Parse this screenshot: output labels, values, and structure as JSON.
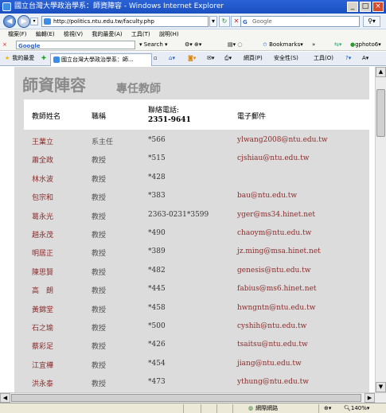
{
  "window": {
    "title": "國立台灣大學政治學系：師資陣容 - Windows Internet Explorer"
  },
  "address": {
    "url": "http://politics.ntu.edu.tw/faculty.php"
  },
  "search": {
    "placeholder": "Google"
  },
  "menu": [
    "檔案(F)",
    "編輯(E)",
    "檢視(V)",
    "我的最愛(A)",
    "工具(T)",
    "說明(H)"
  ],
  "google_toolbar": {
    "logo": "Google",
    "search_label": "Search",
    "bookmarks_label": "Bookmarks",
    "more": "»",
    "gphoto": "gphoto6"
  },
  "tabbar": {
    "favorites": "我的最愛",
    "tab_title": "國立台灣大學政治學系：師...",
    "home_menu": "網頁(P)",
    "safety_menu": "安全性(S)",
    "tools_menu": "工具(O)"
  },
  "page": {
    "title": "師資陣容",
    "subtitle": "專任教師",
    "headers": {
      "name": "教師姓名",
      "title": "職稱",
      "phone": "聯絡電話:",
      "phone_sub": "2351-9641",
      "email": "電子郵件"
    },
    "rows": [
      {
        "name": "王業立",
        "title": "系主任",
        "phone": "*566",
        "email": "ylwang2008@ntu.edu.tw"
      },
      {
        "name": "蕭全政",
        "title": "教授",
        "phone": "*515",
        "email": "cjshiau@ntu.edu.tw"
      },
      {
        "name": "林水波",
        "title": "教授",
        "phone": "*428",
        "email": ""
      },
      {
        "name": "包宗和",
        "title": "教授",
        "phone": "*383",
        "email": "bau@ntu.edu.tw"
      },
      {
        "name": "葛永光",
        "title": "教授",
        "phone": "2363-0231*3599",
        "email": "yger@ms34.hinet.net"
      },
      {
        "name": "趙永茂",
        "title": "教授",
        "phone": "*490",
        "email": "chaoym@ntu.edu.tw"
      },
      {
        "name": "明居正",
        "title": "教授",
        "phone": "*389",
        "email": "jz.ming@msa.hinet.net"
      },
      {
        "name": "陳思賢",
        "title": "教授",
        "phone": "*482",
        "email": "genesis@ntu.edu.tw"
      },
      {
        "name": "高　朗",
        "title": "教授",
        "phone": "*445",
        "email": "fabius@ms6.hinet.net"
      },
      {
        "name": "黃錦堂",
        "title": "教授",
        "phone": "*458",
        "email": "hwngntn@ntu.edu.tw"
      },
      {
        "name": "石之瑜",
        "title": "教授",
        "phone": "*500",
        "email": "cyshih@ntu.edu.tw"
      },
      {
        "name": "蔡彩足",
        "title": "教授",
        "phone": "*426",
        "email": "tsaitsu@ntu.edu.tw"
      },
      {
        "name": "江宜樺",
        "title": "教授",
        "phone": "*454",
        "email": "jiang@ntu.edu.tw"
      },
      {
        "name": "洪永泰",
        "title": "教授",
        "phone": "*473",
        "email": "ythung@ntu.edu.tw"
      }
    ]
  },
  "status": {
    "zone": "網際網路",
    "zoom": "140%"
  }
}
